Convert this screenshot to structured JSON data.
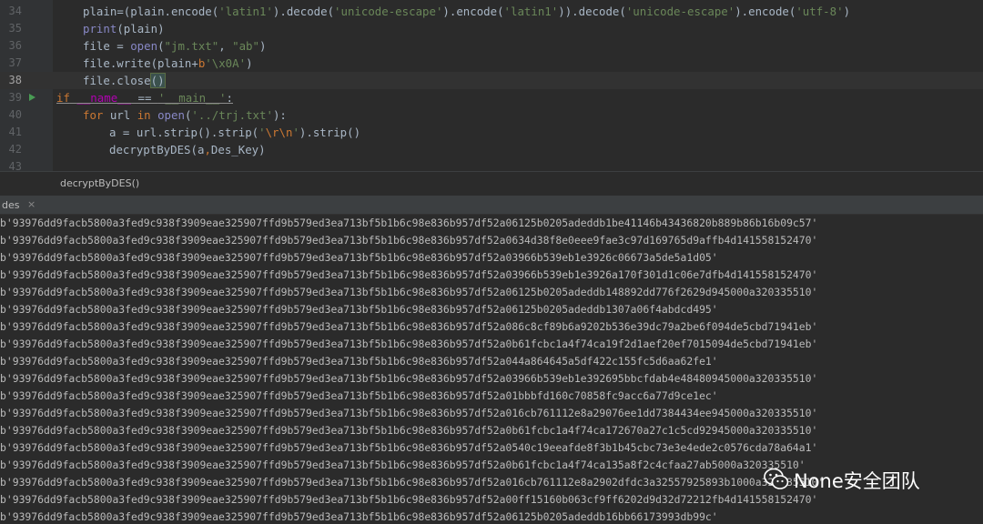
{
  "editor": {
    "lines": [
      {
        "num": "34"
      },
      {
        "num": "35"
      },
      {
        "num": "36"
      },
      {
        "num": "37"
      },
      {
        "num": "38"
      },
      {
        "num": "39"
      },
      {
        "num": "40"
      },
      {
        "num": "41"
      },
      {
        "num": "42"
      },
      {
        "num": "43"
      }
    ],
    "code": {
      "l34": {
        "a": "plain",
        "b": "=(plain.encode(",
        "s1": "'latin1'",
        "c": ").decode(",
        "s2": "'unicode-escape'",
        "d": ").encode(",
        "s3": "'latin1'",
        "e": ")).decode(",
        "s4": "'unicode-escape'",
        "f": ").encode(",
        "s5": "'utf-8'",
        "g": ")"
      },
      "l35": {
        "fn": "print",
        "rest": "(plain)"
      },
      "l36": {
        "a": "file = ",
        "fn": "open",
        "b": "(",
        "s1": "\"jm.txt\"",
        "c": ", ",
        "s2": "\"ab\"",
        "d": ")"
      },
      "l37": {
        "a": "file.write(plain+",
        "kw": "b",
        "s": "'\\x0A'",
        "b": ")"
      },
      "l38": {
        "a": "file.close",
        "p": "()"
      },
      "l39": {
        "kw": "if",
        "a": " ",
        "d1": "__name__",
        "b": " == ",
        "s": "'__main__'",
        "c": ":"
      },
      "l40": {
        "kw1": "for",
        "a": " url ",
        "kw2": "in",
        "b": " ",
        "fn": "open",
        "c": "(",
        "s": "'../trj.txt'",
        "d": "):"
      },
      "l41": {
        "a": "a = url.strip().strip(",
        "s1": "'",
        "esc": "\\r\\n",
        "s2": "'",
        "b": ").strip()"
      },
      "l42": {
        "a": "decryptByDES(a",
        "b": ",",
        "c": "Des_Key)"
      }
    },
    "breadcrumb": "decryptByDES()"
  },
  "run_panel": {
    "tab_label": "des",
    "close_glyph": "×",
    "output_lines": [
      "b'93976dd9facb5800a3fed9c938f3909eae325907ffd9b579ed3ea713bf5b1b6c98e836b957df52a06125b0205adeddb1be41146b43436820b889b86b16b09c57'",
      "b'93976dd9facb5800a3fed9c938f3909eae325907ffd9b579ed3ea713bf5b1b6c98e836b957df52a0634d38f8e0eee9fae3c97d169765d9affb4d141558152470'",
      "b'93976dd9facb5800a3fed9c938f3909eae325907ffd9b579ed3ea713bf5b1b6c98e836b957df52a03966b539eb1e3926c06673a5de5a1d05'",
      "b'93976dd9facb5800a3fed9c938f3909eae325907ffd9b579ed3ea713bf5b1b6c98e836b957df52a03966b539eb1e3926a170f301d1c06e7dfb4d141558152470'",
      "b'93976dd9facb5800a3fed9c938f3909eae325907ffd9b579ed3ea713bf5b1b6c98e836b957df52a06125b0205adeddb148892dd776f2629d945000a320335510'",
      "b'93976dd9facb5800a3fed9c938f3909eae325907ffd9b579ed3ea713bf5b1b6c98e836b957df52a06125b0205adeddb1307a06f4abdcd495'",
      "b'93976dd9facb5800a3fed9c938f3909eae325907ffd9b579ed3ea713bf5b1b6c98e836b957df52a086c8cf89b6a9202b536e39dc79a2be6f094de5cbd71941eb'",
      "b'93976dd9facb5800a3fed9c938f3909eae325907ffd9b579ed3ea713bf5b1b6c98e836b957df52a0b61fcbc1a4f74ca19f2d1aef20ef7015094de5cbd71941eb'",
      "b'93976dd9facb5800a3fed9c938f3909eae325907ffd9b579ed3ea713bf5b1b6c98e836b957df52a044a864645a5df422c155fc5d6aa62fe1'",
      "b'93976dd9facb5800a3fed9c938f3909eae325907ffd9b579ed3ea713bf5b1b6c98e836b957df52a03966b539eb1e392695bbcfdab4e48480945000a320335510'",
      "b'93976dd9facb5800a3fed9c938f3909eae325907ffd9b579ed3ea713bf5b1b6c98e836b957df52a01bbbfd160c70858fc9acc6a77d9ce1ec'",
      "b'93976dd9facb5800a3fed9c938f3909eae325907ffd9b579ed3ea713bf5b1b6c98e836b957df52a016cb761112e8a29076ee1dd7384434ee945000a320335510'",
      "b'93976dd9facb5800a3fed9c938f3909eae325907ffd9b579ed3ea713bf5b1b6c98e836b957df52a0b61fcbc1a4f74ca172670a27c1c5cd92945000a320335510'",
      "b'93976dd9facb5800a3fed9c938f3909eae325907ffd9b579ed3ea713bf5b1b6c98e836b957df52a0540c19eeafde8f3b1b45cbc73e3e4ede2c0576cda78a64a1'",
      "b'93976dd9facb5800a3fed9c938f3909eae325907ffd9b579ed3ea713bf5b1b6c98e836b957df52a0b61fcbc1a4f74ca135a8f2c4cfaa27ab5000a320335510'",
      "b'93976dd9facb5800a3fed9c938f3909eae325907ffd9b579ed3ea713bf5b1b6c98e836b957df52a016cb761112e8a2902dfdc3a32557925893b1000a320335510'",
      "b'93976dd9facb5800a3fed9c938f3909eae325907ffd9b579ed3ea713bf5b1b6c98e836b957df52a00ff15160b063cf9ff6202d9d32d72212fb4d141558152470'",
      "b'93976dd9facb5800a3fed9c938f3909eae325907ffd9b579ed3ea713bf5b1b6c98e836b957df52a06125b0205adeddb16bb66173993db99c'"
    ]
  },
  "watermark": {
    "text": "None安全团队",
    "icon": "wechat-icon"
  },
  "colors": {
    "background": "#2b2b2b",
    "gutter": "#313335",
    "keyword": "#cc7832",
    "string": "#6a8759",
    "builtin": "#8888c6",
    "dunder": "#b200b2",
    "text": "#a9b7c6",
    "console_text": "#bbbbbb",
    "run_icon": "#499c54"
  }
}
